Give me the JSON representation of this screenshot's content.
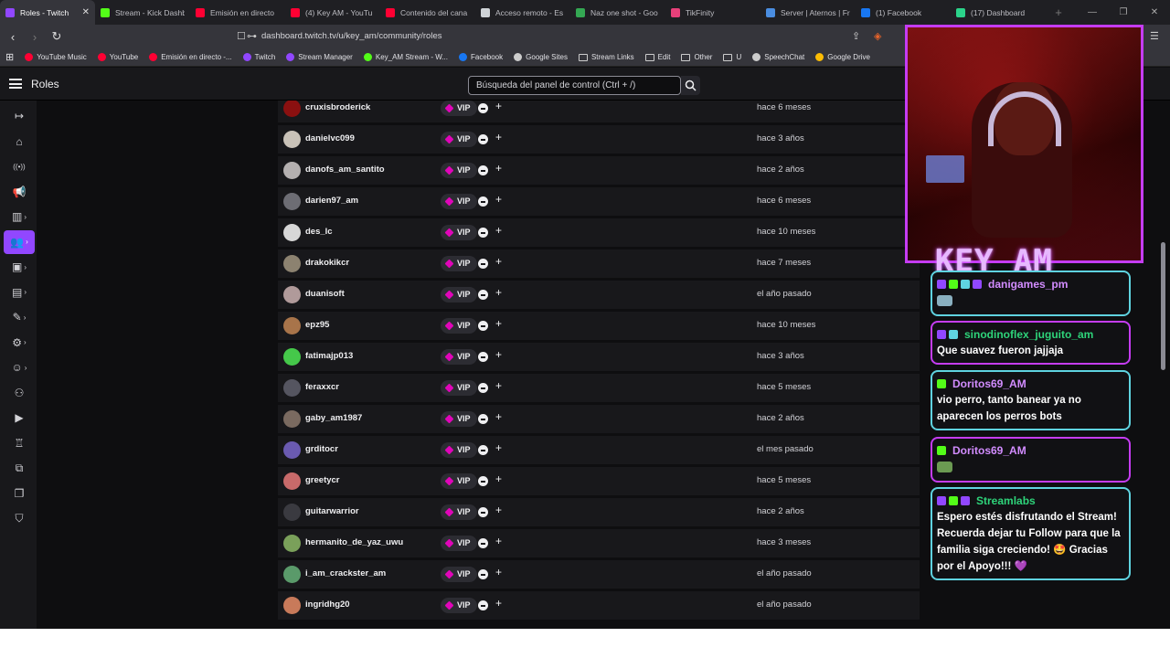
{
  "browser": {
    "tabs": [
      {
        "label": "Roles - Twitch",
        "color": "#9147ff",
        "active": true
      },
      {
        "label": "Stream - Kick Dashb",
        "color": "#53fc18"
      },
      {
        "label": "Emisión en directo",
        "color": "#ff0033"
      },
      {
        "label": "(4) Key AM - YouTu",
        "color": "#ff0033"
      },
      {
        "label": "Contenido del cana",
        "color": "#ff0033"
      },
      {
        "label": "Acceso remoto - Es",
        "color": "#cfd3d7"
      },
      {
        "label": "Naz one shot - Goo",
        "color": "#34a853"
      },
      {
        "label": "TikFinity",
        "color": "#e8407a"
      },
      {
        "label": "Server | Aternos | Fr",
        "color": "#4a8de0"
      },
      {
        "label": "(1) Facebook",
        "color": "#1877f2"
      },
      {
        "label": "(17) Dashboard",
        "color": "#2bd38a"
      }
    ],
    "url": "dashboard.twitch.tv/u/key_am/community/roles",
    "bookmarks": [
      {
        "label": "YouTube Music",
        "color": "#ff0033"
      },
      {
        "label": "YouTube",
        "color": "#ff0033"
      },
      {
        "label": "Emisión en directo -...",
        "color": "#ff0033"
      },
      {
        "label": "Twitch",
        "color": "#9147ff"
      },
      {
        "label": "Stream Manager",
        "color": "#9147ff"
      },
      {
        "label": "Key_AM Stream - W...",
        "color": "#53fc18"
      },
      {
        "label": "Facebook",
        "color": "#1877f2"
      },
      {
        "label": "Google Sites",
        "color": "#cccccc"
      },
      {
        "label": "Stream Links",
        "folder": true
      },
      {
        "label": "Edit",
        "folder": true
      },
      {
        "label": "Other",
        "folder": true
      },
      {
        "label": "U",
        "folder": true
      },
      {
        "label": "SpeechChat",
        "color": "#cccccc"
      },
      {
        "label": "Google Drive",
        "color": "#fbbc04"
      }
    ]
  },
  "header": {
    "title": "Roles",
    "search_placeholder": "Búsqueda del panel de control (Ctrl + /)"
  },
  "sidenav": [
    {
      "icon": "collapse-icon",
      "glyph": "↦"
    },
    {
      "icon": "home-icon",
      "glyph": "⌂"
    },
    {
      "icon": "broadcast-icon",
      "glyph": "((•))"
    },
    {
      "icon": "megaphone-icon",
      "glyph": "📢"
    },
    {
      "icon": "analytics-icon",
      "glyph": "▥",
      "chevron": true
    },
    {
      "icon": "community-icon",
      "glyph": "👥",
      "chevron": true,
      "active": true
    },
    {
      "icon": "content-icon",
      "glyph": "▣",
      "chevron": true
    },
    {
      "icon": "monetization-icon",
      "glyph": "▤",
      "chevron": true
    },
    {
      "icon": "creator-tools-icon",
      "glyph": "✎",
      "chevron": true
    },
    {
      "icon": "settings-icon",
      "glyph": "⚙",
      "chevron": true
    },
    {
      "icon": "viewer-rewards-icon",
      "glyph": "☺",
      "chevron": true
    },
    {
      "icon": "add-user-icon",
      "glyph": "⚇"
    },
    {
      "icon": "video-icon",
      "glyph": "▶"
    },
    {
      "icon": "trophy-icon",
      "glyph": "♖"
    },
    {
      "icon": "extensions-icon",
      "glyph": "⧉"
    },
    {
      "icon": "book-icon",
      "glyph": "❐"
    },
    {
      "icon": "shield-icon",
      "glyph": "⛉"
    }
  ],
  "roles": {
    "badge_label": "VIP",
    "rows": [
      {
        "user": "cruxisbroderick",
        "added": "hace 6 meses",
        "avatar": "#8a1010"
      },
      {
        "user": "danielvc099",
        "added": "hace 3 años",
        "avatar": "#c9c2b8"
      },
      {
        "user": "danofs_am_santito",
        "added": "hace 2 años",
        "avatar": "#b4b0b0"
      },
      {
        "user": "darien97_am",
        "added": "hace 6 meses",
        "avatar": "#6d6d74"
      },
      {
        "user": "des_lc",
        "added": "hace 10 meses",
        "avatar": "#d7d7d7"
      },
      {
        "user": "drakokikcr",
        "added": "hace 7 meses",
        "avatar": "#8c8270"
      },
      {
        "user": "duanisoft",
        "added": "el año pasado",
        "avatar": "#b09a9a"
      },
      {
        "user": "epz95",
        "added": "hace 10 meses",
        "avatar": "#a8744a"
      },
      {
        "user": "fatimajp013",
        "added": "hace 3 años",
        "avatar": "#45c84a"
      },
      {
        "user": "feraxxcr",
        "added": "hace 5 meses",
        "avatar": "#555560"
      },
      {
        "user": "gaby_am1987",
        "added": "hace 2 años",
        "avatar": "#7a6a60"
      },
      {
        "user": "grditocr",
        "added": "el mes pasado",
        "avatar": "#6a5ab0"
      },
      {
        "user": "greetycr",
        "added": "hace 5 meses",
        "avatar": "#c86a6a"
      },
      {
        "user": "guitarwarrior",
        "added": "hace 2 años",
        "avatar": "#3a3a40"
      },
      {
        "user": "hermanito_de_yaz_uwu",
        "added": "hace 3 meses",
        "avatar": "#7aa05a"
      },
      {
        "user": "i_am_crackster_am",
        "added": "el año pasado",
        "avatar": "#5a9a6a"
      },
      {
        "user": "ingridhg20",
        "added": "el año pasado",
        "avatar": "#c87a5a"
      }
    ]
  },
  "stream": {
    "channel_logo": "KEY_AM",
    "chat": [
      {
        "user": "danigames_pm",
        "user_color": "#d28cff",
        "border": "#5fd3e0",
        "message": "",
        "emote": "#8ab0c0",
        "icons": [
          "#9147ff",
          "#53fc18",
          "#5fd3e0",
          "#9147ff"
        ]
      },
      {
        "user": "sinodinoflex_juguito_am",
        "user_color": "#2ed47a",
        "border": "#c53cf3",
        "message": "Que suavez fueron jajjaja",
        "icons": [
          "#9147ff",
          "#5fd3e0"
        ]
      },
      {
        "user": "Doritos69_AM",
        "user_color": "#d28cff",
        "border": "#5fd3e0",
        "message": "vio perro, tanto banear ya no aparecen los perros bots",
        "icons": [
          "#53fc18"
        ]
      },
      {
        "user": "Doritos69_AM",
        "user_color": "#d28cff",
        "border": "#c53cf3",
        "message": "",
        "emote": "#6b9a52",
        "icons": [
          "#53fc18"
        ]
      },
      {
        "user": "Streamlabs",
        "user_color": "#2ed47a",
        "border": "#5fd3e0",
        "message": "Espero estés disfrutando el Stream! Recuerda dejar tu Follow para que la familia siga creciendo! 🤩 Gracias por el Apoyo!!! 💜",
        "icons": [
          "#9147ff",
          "#53fc18",
          "#9147ff"
        ]
      }
    ]
  }
}
